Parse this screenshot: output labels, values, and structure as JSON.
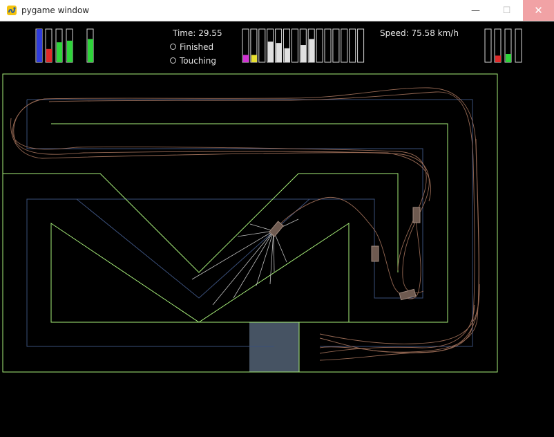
{
  "window": {
    "title": "pygame window",
    "controls": {
      "minimize": "—",
      "maximize": "☐",
      "close": "✕"
    }
  },
  "hud": {
    "time_label": "Time: 29.55",
    "finished_label": "Finished",
    "touching_label": "Touching",
    "speed_label": "Speed: 75.58 km/h",
    "colors": {
      "text": "#e6e6e6",
      "bar_outline": "#d9d9d9"
    },
    "control_bars": [
      {
        "fill": 1.0,
        "color": "#2f3cdc"
      },
      {
        "fill": 0.4,
        "color": "#e02a2a"
      },
      {
        "fill": 0.6,
        "color": "#2ed43a"
      },
      {
        "fill": 0.65,
        "color": "#2ed43a"
      },
      {
        "fill": 0.7,
        "color": "#2ed43a"
      }
    ],
    "sensor_bars": [
      {
        "fill": 0.22,
        "color": "#d033d3"
      },
      {
        "fill": 0.22,
        "color": "#e8e030"
      },
      {
        "fill": 0.0,
        "color": "#e0e0e0"
      },
      {
        "fill": 0.62,
        "color": "#e0e0e0"
      },
      {
        "fill": 0.58,
        "color": "#e0e0e0"
      },
      {
        "fill": 0.42,
        "color": "#e0e0e0"
      },
      {
        "fill": 0.0,
        "color": "#e0e0e0"
      },
      {
        "fill": 0.52,
        "color": "#e0e0e0"
      },
      {
        "fill": 0.7,
        "color": "#e0e0e0"
      },
      {
        "fill": 0.0,
        "color": "#e0e0e0"
      },
      {
        "fill": 0.0,
        "color": "#e0e0e0"
      },
      {
        "fill": 0.0,
        "color": "#e0e0e0"
      },
      {
        "fill": 0.0,
        "color": "#e0e0e0"
      },
      {
        "fill": 0.0,
        "color": "#e0e0e0"
      },
      {
        "fill": 0.0,
        "color": "#e0e0e0"
      }
    ],
    "right_bars": [
      {
        "fill": 0.0,
        "color": "#e02a2a"
      },
      {
        "fill": 0.2,
        "color": "#e02a2a"
      },
      {
        "fill": 0.25,
        "color": "#2ed43a"
      },
      {
        "fill": 0.0,
        "color": "#2ed43a"
      }
    ]
  },
  "track": {
    "wall_color": "#a8f07a",
    "centerline_color": "#3a4f7a",
    "start_zone_color": "#465363",
    "trail_color": "#b07b62",
    "ray_color": "#d8d8d8",
    "car_color": "#6e5a50",
    "car_outline": "#a08a7e"
  }
}
